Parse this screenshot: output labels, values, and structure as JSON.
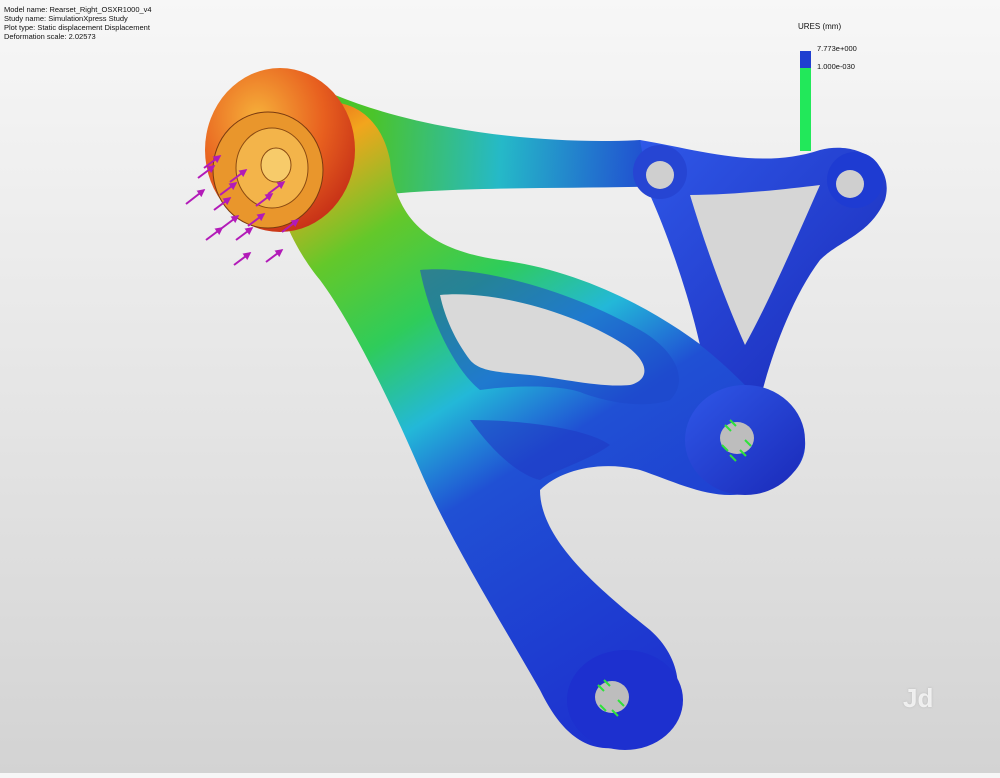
{
  "info": {
    "model_name": "Model name: Rearset_Right_OSXR1000_v4",
    "study_name": "Study name: SimulationXpress Study",
    "plot_type": "Plot type: Static displacement Displacement",
    "deformation_scale": "Deformation scale: 2.02573"
  },
  "legend": {
    "title": "URES (mm)",
    "max_value": "7.773e+000",
    "min_value": "1.000e-030",
    "colors": {
      "max": "#1f3fd0",
      "min": "#22e85a"
    }
  },
  "watermark": "Jd",
  "icons": {
    "load_arrows": "force-arrow-icon",
    "fixtures": "fixed-geometry-icon"
  },
  "colors": {
    "displacement_max": "#e3301b",
    "displacement_high": "#f2a51d",
    "displacement_mid": "#3bd02a",
    "displacement_low": "#23b8d8",
    "displacement_min": "#1d30cf",
    "load_arrow": "#b21ab8",
    "fixture": "#2ee23a"
  }
}
